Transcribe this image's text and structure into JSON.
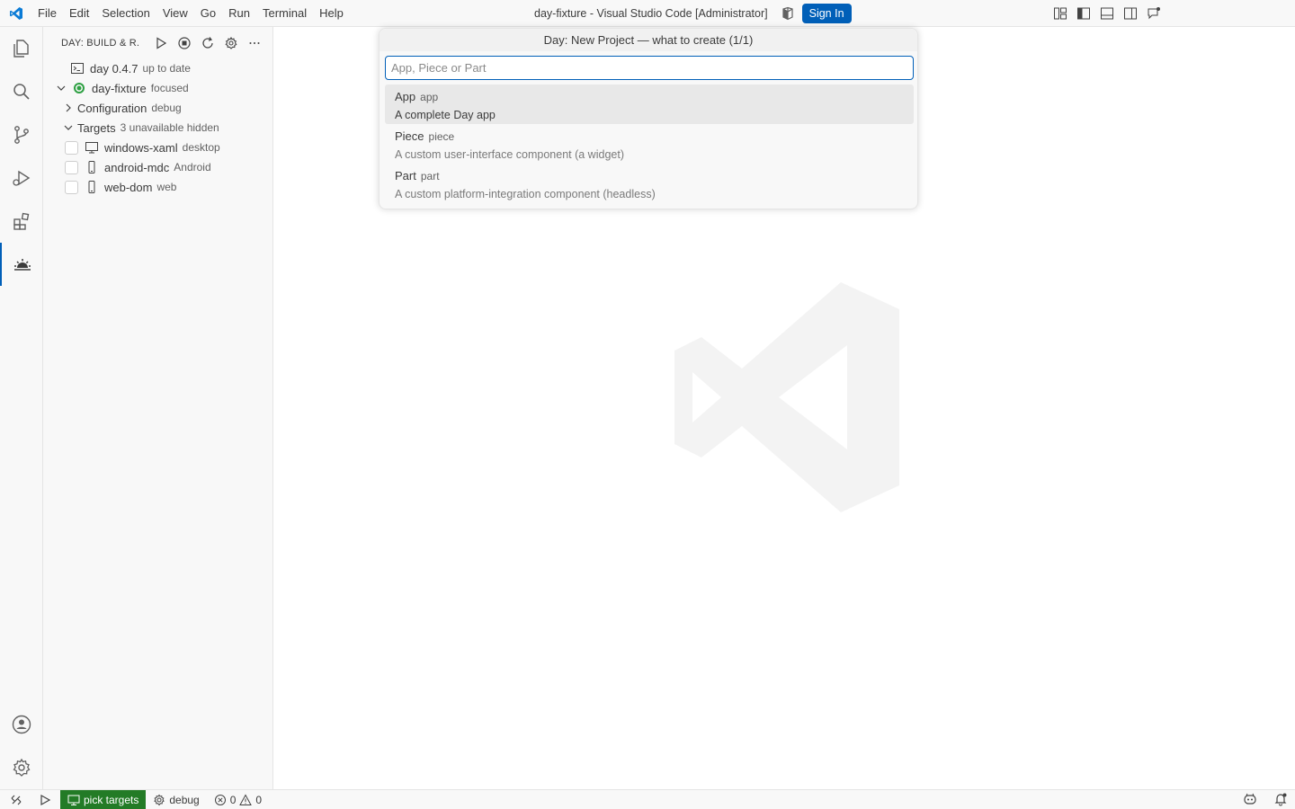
{
  "titlebar": {
    "menu": [
      "File",
      "Edit",
      "Selection",
      "View",
      "Go",
      "Run",
      "Terminal",
      "Help"
    ],
    "title": "day-fixture - Visual Studio Code [Administrator]",
    "sign_in_label": "Sign In"
  },
  "sidebar": {
    "title": "DAY: BUILD & R...",
    "rows": {
      "tool": {
        "label": "day 0.4.7",
        "desc": "up to date"
      },
      "project": {
        "label": "day-fixture",
        "desc": "focused"
      },
      "configuration": {
        "label": "Configuration",
        "desc": "debug"
      },
      "targets": {
        "label": "Targets",
        "desc": "3 unavailable hidden"
      },
      "target_items": [
        {
          "label": "windows-xaml",
          "desc": "desktop",
          "icon": "desktop-icon"
        },
        {
          "label": "android-mdc",
          "desc": "Android",
          "icon": "phone-icon"
        },
        {
          "label": "web-dom",
          "desc": "web",
          "icon": "phone-icon"
        }
      ]
    }
  },
  "quickpick": {
    "title": "Day: New Project — what to create (1/1)",
    "placeholder": "App, Piece or Part",
    "items": [
      {
        "label": "App",
        "sub": "app",
        "detail": "A complete Day app"
      },
      {
        "label": "Piece",
        "sub": "piece",
        "detail": "A custom user-interface component (a widget)"
      },
      {
        "label": "Part",
        "sub": "part",
        "detail": "A custom platform-integration component (headless)"
      }
    ]
  },
  "statusbar": {
    "pick_targets": "pick targets",
    "config": "debug",
    "errors": "0",
    "warnings": "0"
  },
  "colors": {
    "accent": "#005fb8",
    "status_highlight": "#237b26",
    "running_dot": "#2ea043"
  }
}
